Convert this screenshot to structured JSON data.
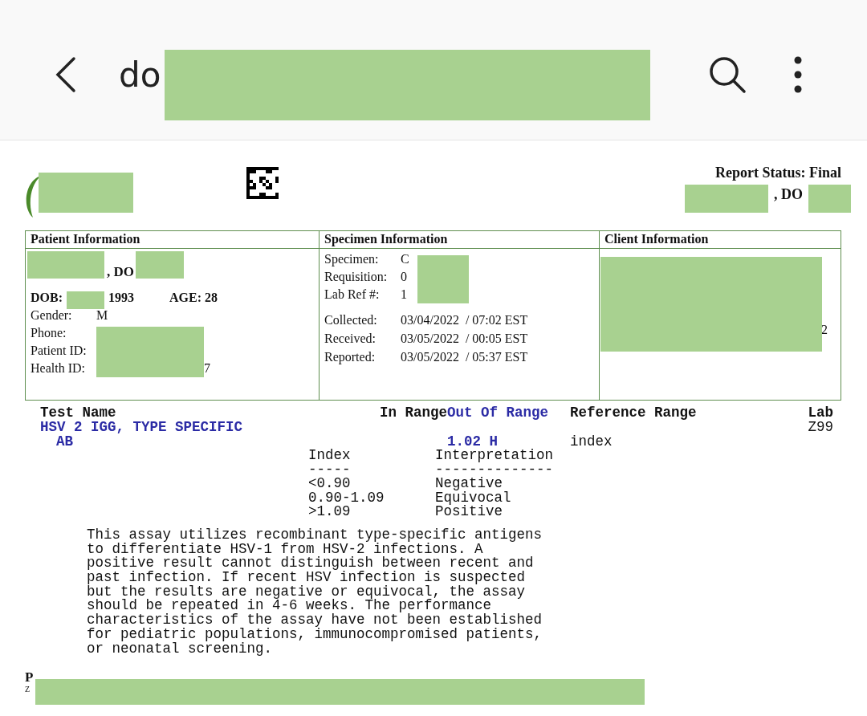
{
  "app_bar": {
    "title": "do"
  },
  "report": {
    "status": "Report Status: Final",
    "physician_suffix": ", DO"
  },
  "patient": {
    "heading": "Patient Information",
    "name_suffix": ", DO",
    "dob_label": "DOB:",
    "dob_value": "1993",
    "age": "AGE: 28",
    "fields": [
      {
        "label": "Gender:",
        "value": "M"
      },
      {
        "label": "Phone:"
      },
      {
        "label": "Patient ID:"
      },
      {
        "label": "Health ID:",
        "value": "7"
      }
    ]
  },
  "specimen": {
    "heading": "Specimen Information",
    "fields": [
      {
        "label": "Specimen:",
        "value": "C"
      },
      {
        "label": "Requisition:",
        "value": "0"
      },
      {
        "label": "Lab Ref #:",
        "value": "1"
      }
    ],
    "dates": [
      {
        "label": "Collected:",
        "value": "03/04/2022  / 07:02 EST"
      },
      {
        "label": "Received:",
        "value": "03/05/2022  / 00:05 EST"
      },
      {
        "label": "Reported:",
        "value": "03/05/2022  / 05:37 EST"
      }
    ]
  },
  "client": {
    "heading": "Client Information",
    "visible_text": "2"
  },
  "results": {
    "columns": [
      {
        "label": "Test Name",
        "kind": "plain"
      },
      {
        "label": "In Range",
        "kind": "plain"
      },
      {
        "label": "Out Of Range",
        "kind": "flag"
      },
      {
        "label": "Reference Range",
        "kind": "plain"
      },
      {
        "label": "Lab",
        "kind": "plain"
      }
    ],
    "test_name": "HSV 2 IGG, TYPE SPECIFIC",
    "lab": "Z99",
    "analyte": "AB",
    "out_of_range": "1.02 H",
    "reference": "index",
    "interpretation": {
      "headers": [
        "Index",
        "Interpretation"
      ],
      "rules": [
        "-----",
        "--------------"
      ],
      "rows": [
        [
          "<0.90",
          "Negative"
        ],
        [
          "0.90-1.09",
          "Equivocal"
        ],
        [
          ">1.09",
          "Positive"
        ]
      ]
    },
    "note": "This assay utilizes recombinant type-specific antigens\nto differentiate HSV-1 from HSV-2 infections. A\npositive result cannot distinguish between recent and\npast infection. If recent HSV infection is suspected\nbut the results are negative or equivocal, the assay\nshould be repeated in 4-6 weeks. The performance\ncharacteristics of the assay have not been established\nfor pediatric populations, immunocompromised patients,\nor neonatal screening."
  },
  "footer": {
    "lines": [
      "P",
      "Z"
    ]
  }
}
